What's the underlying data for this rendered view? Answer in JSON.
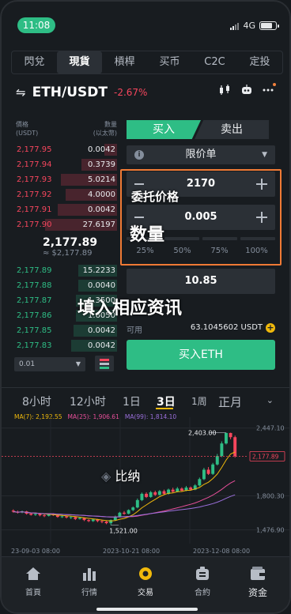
{
  "status_bar": {
    "time": "11:08",
    "network": "4G"
  },
  "tabs": [
    {
      "label": "閃兌",
      "active": false
    },
    {
      "label": "現貨",
      "active": true
    },
    {
      "label": "槓桿",
      "active": false
    },
    {
      "label": "买币",
      "active": false
    },
    {
      "label": "C2C",
      "active": false
    },
    {
      "label": "定投",
      "active": false
    }
  ],
  "pair": {
    "switch_icon": "⇋",
    "name": "ETH/USDT",
    "change": "-2.67%"
  },
  "header_icons": [
    "candlestick-icon",
    "robot-icon",
    "more-icon"
  ],
  "orderbook": {
    "price_header": "價格",
    "price_unit": "(USDT)",
    "qty_header": "數量",
    "qty_unit": "(以太幣)",
    "asks": [
      {
        "price": "2,177.95",
        "qty": "0.0042",
        "depth": 0.12
      },
      {
        "price": "2,177.94",
        "qty": "0.3739",
        "depth": 0.35
      },
      {
        "price": "2,177.93",
        "qty": "5.0214",
        "depth": 0.55
      },
      {
        "price": "2,177.92",
        "qty": "4.0000",
        "depth": 0.5
      },
      {
        "price": "2,177.91",
        "qty": "0.0042",
        "depth": 0.58
      },
      {
        "price": "2,177.90",
        "qty": "27.6197",
        "depth": 0.7
      }
    ],
    "mid_price": "2,177.89",
    "mid_sub": "≈ $2,177.89",
    "bids": [
      {
        "price": "2,177.89",
        "qty": "15.2233",
        "depth": 0.38
      },
      {
        "price": "2,177.88",
        "qty": "0.0040",
        "depth": 0.38
      },
      {
        "price": "2,177.87",
        "qty": "1.3500",
        "depth": 0.4
      },
      {
        "price": "2,177.86",
        "qty": "1.6050",
        "depth": 0.4
      },
      {
        "price": "2,177.85",
        "qty": "0.0042",
        "depth": 0.42
      },
      {
        "price": "2,177.83",
        "qty": "0.0042",
        "depth": 0.45
      }
    ],
    "depth_select": "0.01"
  },
  "order_panel": {
    "buy_label": "买入",
    "sell_label": "卖出",
    "order_type": "限价单",
    "price_value": "2170",
    "qty_value": "0.005",
    "percentages": [
      "25%",
      "50%",
      "75%",
      "100%"
    ],
    "total_value": "10.85",
    "available_label": "可用",
    "available_amount": "63.1045602 USDT",
    "buy_button": "买入ETH"
  },
  "annotations": {
    "price_label": "委托价格",
    "qty_label": "数量",
    "fill_label": "填入相应资讯",
    "watermark": "比纳"
  },
  "intervals": [
    {
      "label": "8小时",
      "active": false
    },
    {
      "label": "12小时",
      "active": false
    },
    {
      "label": "1日",
      "active": false
    },
    {
      "label": "3日",
      "active": true
    },
    {
      "label": "1周",
      "active": false
    },
    {
      "label": "正月",
      "active": false
    }
  ],
  "ma_legend": [
    {
      "label": "MA(7): 2,192.55",
      "color": "#f0b90b"
    },
    {
      "label": "MA(25): 1,906.61",
      "color": "#e84f9a"
    },
    {
      "label": "MA(99): 1,814.10",
      "color": "#9b6fdc"
    }
  ],
  "chart_data": {
    "type": "candlestick",
    "y_ticks": [
      "2,447.10",
      "1,800.30",
      "1,476.90"
    ],
    "y_tick_values": [
      2447.1,
      1800.3,
      1476.9
    ],
    "x_ticks": [
      "23-09-03 08:00",
      "2023-10-21 08:00",
      "2023-12-08 08:00"
    ],
    "high_label": "2,403.00",
    "low_label": "1,521.00",
    "last_price_label": "2,177.89",
    "ylim": [
      1420,
      2520
    ],
    "candles": [
      [
        1660,
        1650,
        1672,
        1640
      ],
      [
        1650,
        1640,
        1660,
        1632
      ],
      [
        1642,
        1652,
        1660,
        1635
      ],
      [
        1652,
        1630,
        1658,
        1622
      ],
      [
        1632,
        1620,
        1640,
        1612
      ],
      [
        1620,
        1628,
        1640,
        1610
      ],
      [
        1628,
        1615,
        1633,
        1605
      ],
      [
        1615,
        1610,
        1625,
        1598
      ],
      [
        1610,
        1625,
        1632,
        1604
      ],
      [
        1625,
        1618,
        1635,
        1608
      ],
      [
        1618,
        1600,
        1622,
        1592
      ],
      [
        1600,
        1605,
        1615,
        1590
      ],
      [
        1605,
        1595,
        1612,
        1585
      ],
      [
        1595,
        1598,
        1608,
        1580
      ],
      [
        1598,
        1580,
        1602,
        1570
      ],
      [
        1580,
        1590,
        1598,
        1575
      ],
      [
        1590,
        1570,
        1595,
        1560
      ],
      [
        1570,
        1560,
        1578,
        1550
      ],
      [
        1560,
        1575,
        1582,
        1552
      ],
      [
        1575,
        1560,
        1580,
        1548
      ],
      [
        1560,
        1555,
        1568,
        1540
      ],
      [
        1555,
        1540,
        1562,
        1530
      ],
      [
        1540,
        1570,
        1575,
        1521
      ],
      [
        1570,
        1600,
        1612,
        1562
      ],
      [
        1600,
        1640,
        1648,
        1595
      ],
      [
        1640,
        1630,
        1655,
        1620
      ],
      [
        1630,
        1665,
        1672,
        1625
      ],
      [
        1665,
        1690,
        1700,
        1655
      ],
      [
        1690,
        1760,
        1775,
        1682
      ],
      [
        1760,
        1820,
        1832,
        1750
      ],
      [
        1820,
        1790,
        1835,
        1780
      ],
      [
        1790,
        1835,
        1848,
        1782
      ],
      [
        1835,
        1810,
        1850,
        1800
      ],
      [
        1810,
        1845,
        1856,
        1804
      ],
      [
        1845,
        1820,
        1860,
        1810
      ],
      [
        1820,
        1860,
        1870,
        1812
      ],
      [
        1860,
        1840,
        1878,
        1830
      ],
      [
        1840,
        1870,
        1885,
        1835
      ],
      [
        1870,
        1850,
        1882,
        1842
      ],
      [
        1850,
        1880,
        1895,
        1845
      ],
      [
        1880,
        1860,
        1890,
        1850
      ],
      [
        1860,
        1900,
        1912,
        1855
      ],
      [
        1900,
        1960,
        1975,
        1890
      ],
      [
        1960,
        2050,
        2068,
        1950
      ],
      [
        2050,
        2010,
        2075,
        2000
      ],
      [
        2010,
        2100,
        2115,
        2000
      ],
      [
        2100,
        2180,
        2200,
        2090
      ],
      [
        2180,
        2300,
        2320,
        2170
      ],
      [
        2300,
        2400,
        2403,
        2290
      ],
      [
        2400,
        2360,
        2403,
        2340
      ],
      [
        2360,
        2178,
        2375,
        2165
      ]
    ]
  },
  "bottom_nav": [
    {
      "label": "首頁",
      "icon": "home-icon",
      "active": false
    },
    {
      "label": "行情",
      "icon": "markets-icon",
      "active": false
    },
    {
      "label": "交易",
      "icon": "trade-icon",
      "active": true
    },
    {
      "label": "合約",
      "icon": "futures-icon",
      "active": false
    },
    {
      "label": "资金",
      "icon": "wallet-icon",
      "active": false
    }
  ]
}
